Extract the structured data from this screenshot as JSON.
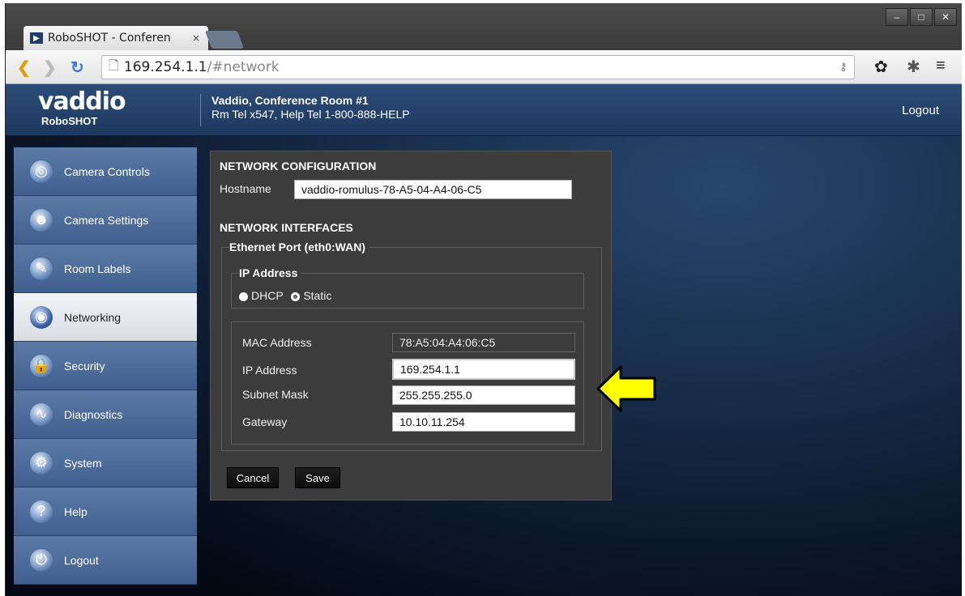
{
  "browser": {
    "tab_title": "RoboSHOT - Conferen",
    "tab_close": "×",
    "window_buttons": [
      "–",
      "□",
      "✕"
    ],
    "url_host": "169.254.1.1",
    "url_path": "/#network",
    "icons": [
      "back-icon",
      "forward-icon",
      "reload-icon",
      "page-icon",
      "key-icon",
      "settings-gear-icon",
      "extension-icon",
      "menu-icon"
    ]
  },
  "header": {
    "brand": "vaddio",
    "product": "RoboSHOT",
    "location": "Vaddio, Conference Room #1",
    "contact": "Rm Tel x547, Help Tel 1-800-888-HELP",
    "logout": "Logout"
  },
  "sidebar": {
    "items": [
      {
        "label": "Camera Controls",
        "icon": "camera-controls-icon",
        "glyph": "◎",
        "active": false
      },
      {
        "label": "Camera Settings",
        "icon": "camera-settings-icon",
        "glyph": "☻",
        "active": false
      },
      {
        "label": "Room Labels",
        "icon": "room-labels-icon",
        "glyph": "✎",
        "active": false
      },
      {
        "label": "Networking",
        "icon": "networking-icon",
        "glyph": "◉",
        "active": true
      },
      {
        "label": "Security",
        "icon": "security-lock-icon",
        "glyph": "🔒",
        "active": false
      },
      {
        "label": "Diagnostics",
        "icon": "diagnostics-icon",
        "glyph": "∿",
        "active": false
      },
      {
        "label": "System",
        "icon": "system-gear-icon",
        "glyph": "⚙",
        "active": false
      },
      {
        "label": "Help",
        "icon": "help-icon",
        "glyph": "?",
        "active": false
      },
      {
        "label": "Logout",
        "icon": "power-icon",
        "glyph": "⏻",
        "active": false
      }
    ]
  },
  "network": {
    "config_title": "NETWORK CONFIGURATION",
    "hostname_label": "Hostname",
    "hostname_value": "vaddio-romulus-78-A5-04-A4-06-C5",
    "interfaces_title": "NETWORK INTERFACES",
    "ethernet_legend": "Ethernet Port (eth0:WAN)",
    "ip_legend": "IP Address",
    "dhcp_label": "DHCP",
    "static_label": "Static",
    "mode_selected": "Static",
    "mac_label": "MAC Address",
    "mac_value": "78:A5:04:A4:06:C5",
    "ip_label": "IP Address",
    "ip_value": "169.254.1.1",
    "subnet_label": "Subnet Mask",
    "subnet_value": "255.255.255.0",
    "gateway_label": "Gateway",
    "gateway_value": "10.10.11.254",
    "cancel_label": "Cancel",
    "save_label": "Save"
  },
  "annotation": {
    "arrow_color": "#ffff00"
  }
}
